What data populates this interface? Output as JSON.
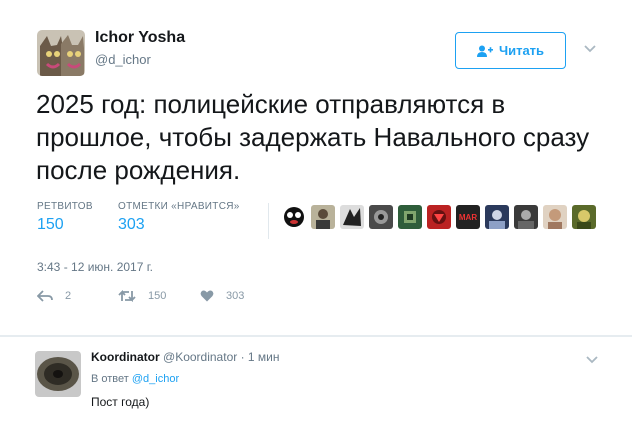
{
  "tweet": {
    "author_name": "Ichor Yosha",
    "author_handle": "@d_ichor",
    "follow_label": "Читать",
    "text": "2025 год: полицейские отправляются в прошлое, чтобы задержать Навального сразу после рождения.",
    "retweets_label": "РЕТВИТОВ",
    "retweets_count": "150",
    "likes_label": "ОТМЕТКИ «НРАВИТСЯ»",
    "likes_count": "303",
    "liker_badge_text": "MAR",
    "timestamp": "3:43 - 12 июн. 2017 г.",
    "actions": {
      "reply_count": "2",
      "retweet_count": "150",
      "like_count": "303"
    }
  },
  "reply": {
    "author_name": "Koordinator",
    "author_handle": "@Koordinator",
    "time": "· 1 мин",
    "in_reply_prefix": "В ответ",
    "in_reply_handle": "@d_ichor",
    "text": "Пост года)"
  },
  "colors": {
    "accent": "#1da1f2",
    "muted": "#657786",
    "icon": "#8899a6",
    "border": "#e1e8ed"
  },
  "icons": [
    "follow-person-icon",
    "chevron-down-icon",
    "reply-icon",
    "retweet-icon",
    "heart-icon"
  ]
}
